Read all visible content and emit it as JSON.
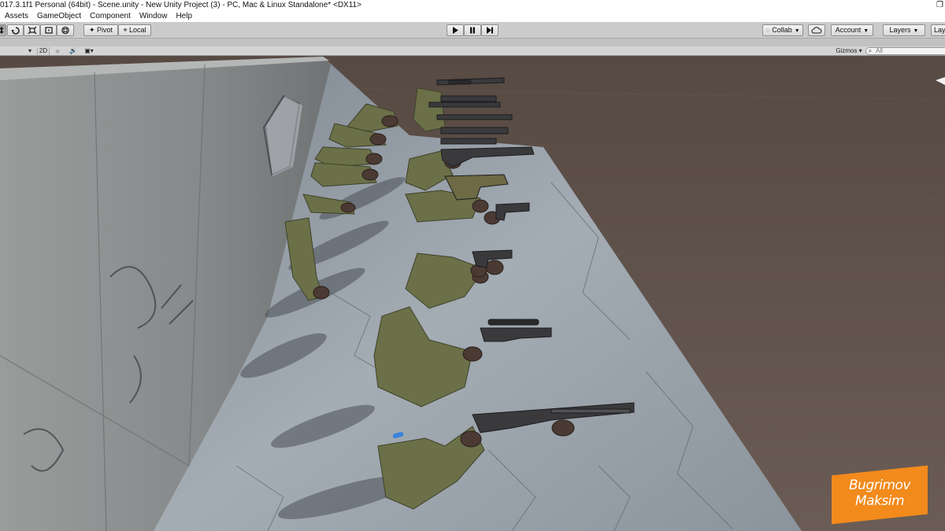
{
  "window": {
    "title": "017.3.1f1 Personal (64bit) - Scene.unity - New Unity Project (3) - PC, Mac & Linux Standalone* <DX11>"
  },
  "menu": [
    "Assets",
    "GameObject",
    "Component",
    "Window",
    "Help"
  ],
  "toolbar": {
    "pivot_label": "Pivot",
    "local_label": "Local",
    "collab_label": "Collab",
    "account_label": "Account",
    "layers_label": "Layers",
    "layout_label": "Lay"
  },
  "scene_view": {
    "mode_2d_label": "2D",
    "gizmos_label": "Gizmos",
    "search_placeholder": "All"
  },
  "watermark": {
    "line1": "Bugrimov",
    "line2": "Maksim"
  },
  "colors": {
    "ground": "#5c5049",
    "platform": "#9aa2ab",
    "wall": "#8d8f8e",
    "sleeve": "#6b7048",
    "weapon": "#3a3a3c",
    "watermark": "#f28a1c"
  }
}
